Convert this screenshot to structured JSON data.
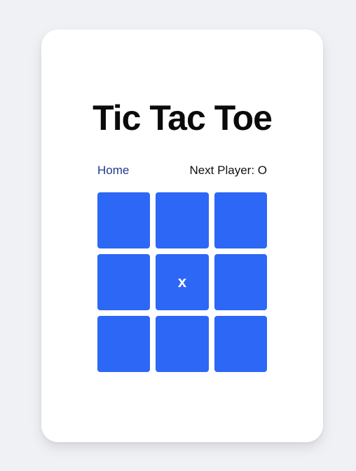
{
  "game": {
    "title": "Tic Tac Toe",
    "home_label": "Home",
    "status_prefix": "Next Player: ",
    "next_player": "O",
    "accent_color": "#2d67f6",
    "board": [
      "",
      "",
      "",
      "",
      "x",
      "",
      "",
      "",
      ""
    ]
  }
}
